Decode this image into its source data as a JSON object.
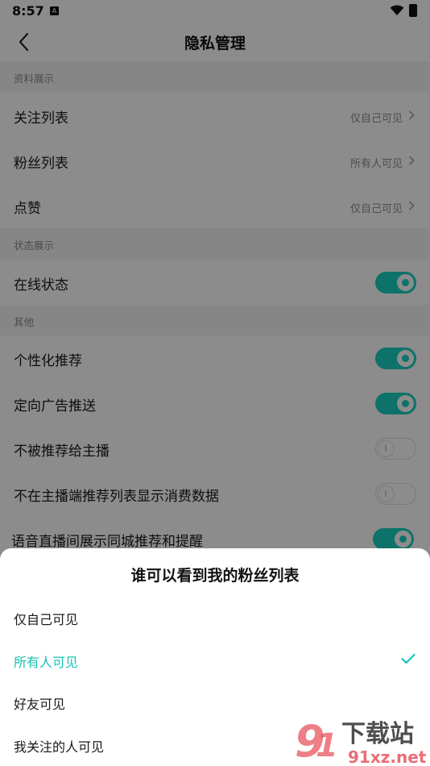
{
  "status_bar": {
    "time": "8:57",
    "a_icon": "A"
  },
  "nav": {
    "title": "隐私管理"
  },
  "sections": [
    {
      "header": "资料展示"
    },
    {
      "header": "状态展示"
    },
    {
      "header": "其他"
    }
  ],
  "profile_rows": [
    {
      "label": "关注列表",
      "value": "仅自己可见"
    },
    {
      "label": "粉丝列表",
      "value": "所有人可见"
    },
    {
      "label": "点赞",
      "value": "仅自己可见"
    }
  ],
  "status_rows": [
    {
      "label": "在线状态",
      "on": true
    }
  ],
  "other_rows": [
    {
      "label": "个性化推荐",
      "on": true
    },
    {
      "label": "定向广告推送",
      "on": true
    },
    {
      "label": "不被推荐给主播",
      "on": false
    },
    {
      "label": "不在主播端推荐列表显示消费数据",
      "on": false
    },
    {
      "label": "语音直播间展示同城推荐和提醒",
      "on": true
    }
  ],
  "sheet": {
    "title": "谁可以看到我的粉丝列表",
    "options": [
      {
        "label": "仅自己可见",
        "selected": false
      },
      {
        "label": "所有人可见",
        "selected": true
      },
      {
        "label": "好友可见",
        "selected": false
      },
      {
        "label": "我关注的人可见",
        "selected": false
      }
    ]
  },
  "watermark": {
    "line1": "下载站",
    "line2": "91xz.net"
  },
  "colors": {
    "accent": "#19cfc0",
    "selected_text": "#14c3b5",
    "overlay": "rgba(0,0,0,0.45)"
  }
}
